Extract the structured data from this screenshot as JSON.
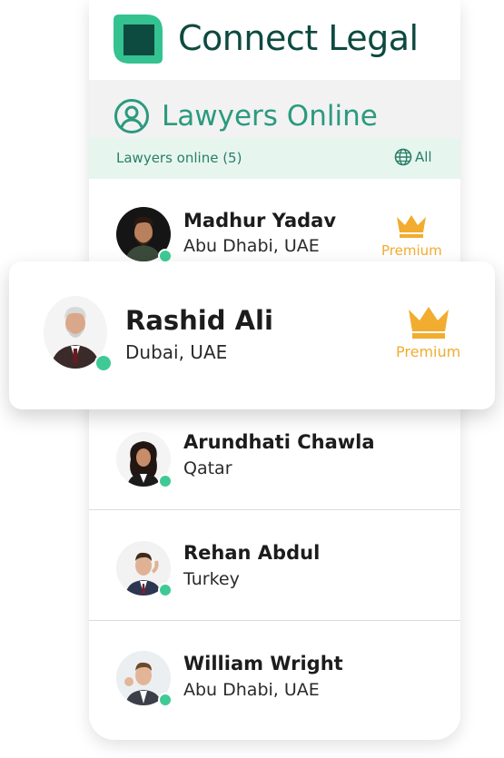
{
  "brand": {
    "name": "Connect Legal",
    "accent": "#0d4a40",
    "logo_light": "#34c290",
    "logo_dark": "#0d4a40"
  },
  "section": {
    "title": "Lawyers Online",
    "icon": "user-circle-icon",
    "color": "#2b9a7e"
  },
  "filter": {
    "count_label": "Lawyers online (5)",
    "all_label": "All",
    "icon": "globe-icon"
  },
  "featured": {
    "name": "Rashid Ali",
    "location": "Dubai, UAE",
    "premium_label": "Premium",
    "online": true
  },
  "lawyers": [
    {
      "name": "Madhur Yadav",
      "location": "Abu Dhabi, UAE",
      "premium_label": "Premium",
      "online": true
    },
    {
      "name": "Arundhati Chawla",
      "location": "Qatar",
      "online": true
    },
    {
      "name": "Rehan Abdul",
      "location": "Turkey",
      "online": true
    },
    {
      "name": "William Wright",
      "location": "Abu Dhabi, UAE",
      "online": true
    }
  ],
  "colors": {
    "online": "#3fca95",
    "premium": "#f2ac2f",
    "filter_bg": "#e6f6ef"
  }
}
